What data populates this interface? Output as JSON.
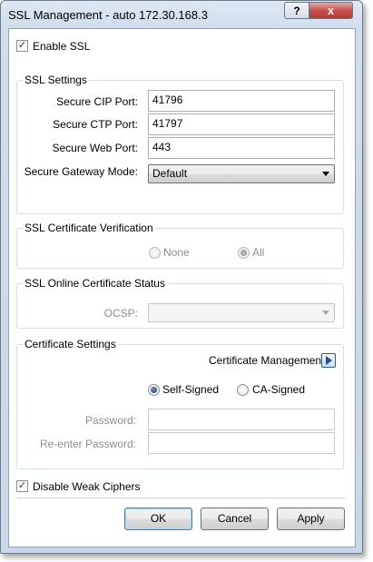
{
  "window": {
    "title": "SSL Management - auto 172.30.168.3",
    "help_glyph": "?",
    "close_glyph": "x"
  },
  "enable_ssl": {
    "label": "Enable SSL",
    "checked": true
  },
  "ssl_settings": {
    "legend": "SSL Settings",
    "secure_cip_port": {
      "label": "Secure CIP Port:",
      "value": "41796"
    },
    "secure_ctp_port": {
      "label": "Secure CTP Port:",
      "value": "41797"
    },
    "secure_web_port": {
      "label": "Secure Web Port:",
      "value": "443"
    },
    "gateway_mode": {
      "label": "Secure Gateway Mode:",
      "value": "Default"
    }
  },
  "cert_verification": {
    "legend": "SSL Certificate Verification",
    "none_label": "None",
    "all_label": "All",
    "selected": "All"
  },
  "online_status": {
    "legend": "SSL Online Certificate Status",
    "ocsp_label": "OCSP:",
    "ocsp_value": ""
  },
  "cert_settings": {
    "legend": "Certificate Settings",
    "management_label": "Certificate Management",
    "self_signed_label": "Self-Signed",
    "ca_signed_label": "CA-Signed",
    "selected": "Self-Signed",
    "password_label": "Password:",
    "reenter_label": "Re-enter Password:"
  },
  "disable_weak_ciphers": {
    "label": "Disable Weak Ciphers",
    "checked": true
  },
  "buttons": {
    "ok": "OK",
    "cancel": "Cancel",
    "apply": "Apply"
  },
  "glyphs": {
    "checkmark": "✓"
  }
}
